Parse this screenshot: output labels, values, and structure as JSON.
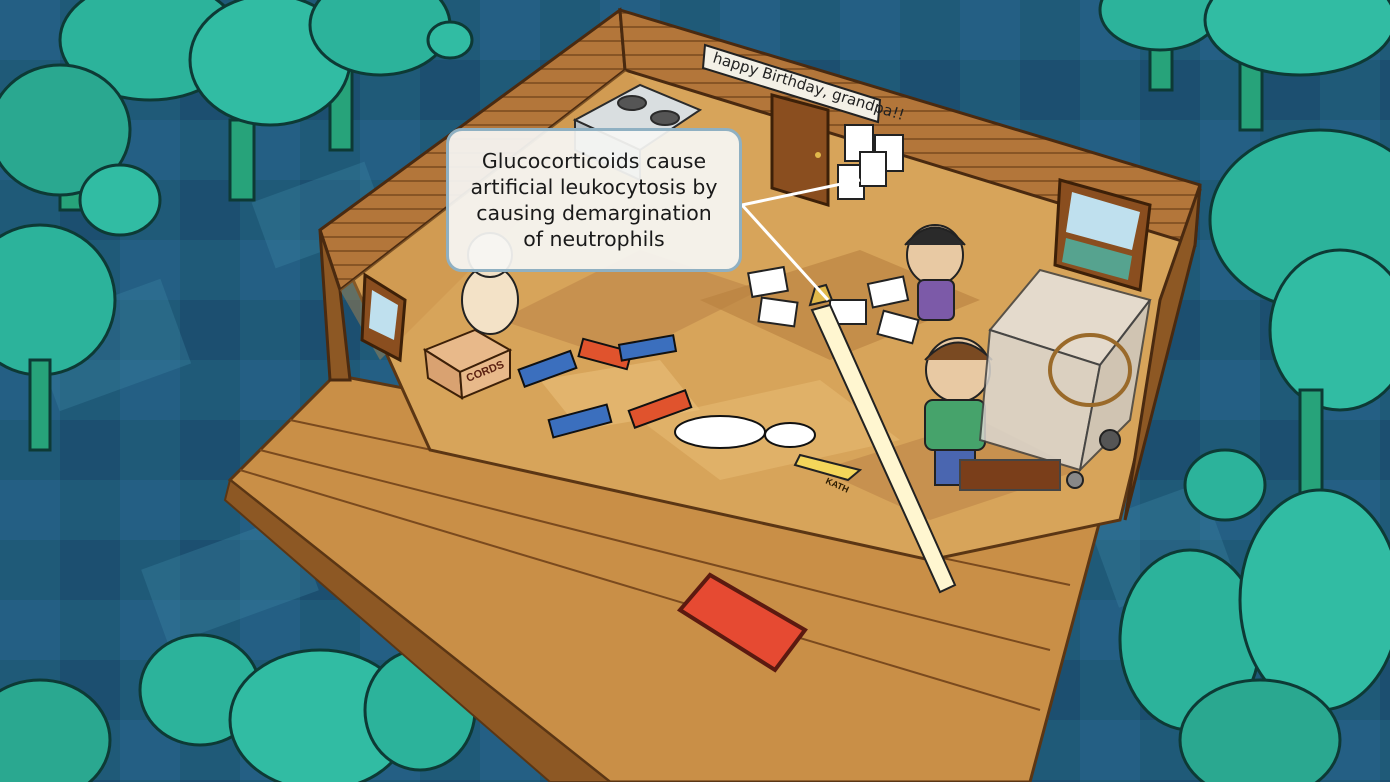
{
  "callout": {
    "line1": "Glucocorticoids cause",
    "line2": "artificial leukocytosis by",
    "line3": "causing demargination",
    "line4": "of neutrophils"
  },
  "banner": {
    "text": "happy Birthday, grandpa!!"
  },
  "box_label": "CORDS",
  "sword_label": "KATH",
  "colors": {
    "background": "#1f5a78",
    "tree": "#2cb39b",
    "floor": "#d7a45a",
    "wall": "#a8692e",
    "callout_border": "#8fb0c2"
  }
}
